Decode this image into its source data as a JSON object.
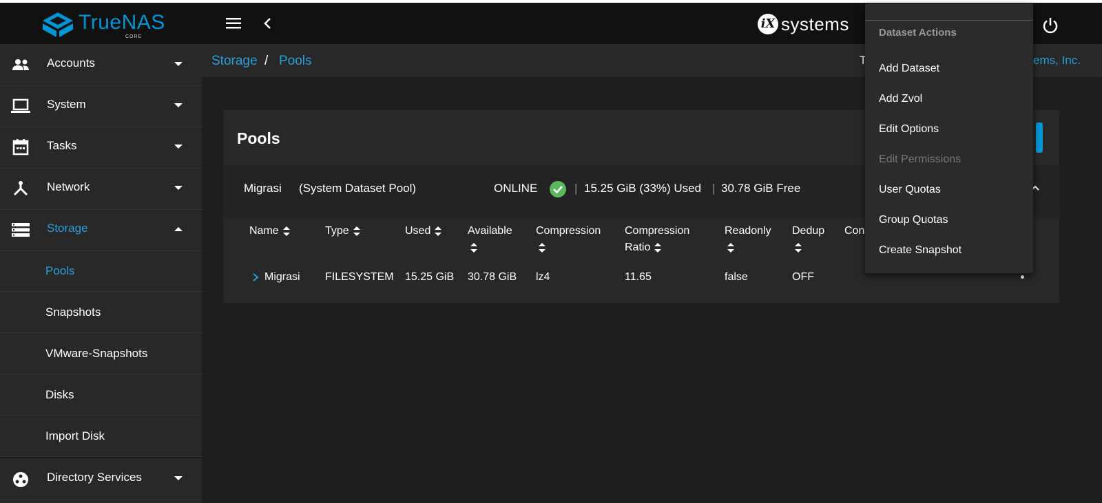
{
  "app": {
    "logo_text": "TrueNAS",
    "logo_sub": "CORE",
    "vendor_prefix": "iX",
    "vendor_text": "systems"
  },
  "icons": {
    "menu": "hamburger-icon",
    "back": "chevron-left-icon",
    "power": "power-icon"
  },
  "colors": {
    "accent": "#0095d5",
    "link": "#2a9fd8",
    "online": "#5cb85c"
  },
  "sidebar": {
    "items": [
      {
        "label": "Accounts",
        "icon": "people-icon"
      },
      {
        "label": "System",
        "icon": "laptop-icon"
      },
      {
        "label": "Tasks",
        "icon": "calendar-icon"
      },
      {
        "label": "Network",
        "icon": "network-icon"
      },
      {
        "label": "Storage",
        "icon": "storage-icon"
      },
      {
        "label": "Directory Services",
        "icon": "directory-icon"
      }
    ],
    "storage_sub": [
      "Pools",
      "Snapshots",
      "VMware-Snapshots",
      "Disks",
      "Import Disk"
    ]
  },
  "breadcrumb": {
    "parent": "Storage",
    "sep": "/",
    "current": "Pools"
  },
  "header_right": {
    "text_start": "T",
    "link_end": "ems, Inc."
  },
  "card": {
    "title": "Pools",
    "pool": {
      "name": "Migrasi",
      "label": "(System Dataset Pool)",
      "status": "ONLINE",
      "bar": "|",
      "used": "15.25 GiB (33%) Used",
      "free": "30.78 GiB Free"
    },
    "columns": {
      "name": "Name",
      "type": "Type",
      "used": "Used",
      "available": "Available",
      "compression": "Compression",
      "ratio_1": "Compression",
      "ratio_2": "Ratio",
      "readonly": "Readonly",
      "dedup": "Dedup",
      "comments": "Con"
    },
    "row": {
      "name": "Migrasi",
      "type": "FILESYSTEM",
      "used": "15.25 GiB",
      "available": "30.78 GiB",
      "compression": "lz4",
      "ratio": "11.65",
      "readonly": "false",
      "dedup": "OFF"
    }
  },
  "menu": {
    "header": "Dataset Actions",
    "items": [
      {
        "label": "Add Dataset"
      },
      {
        "label": "Add Zvol"
      },
      {
        "label": "Edit Options"
      },
      {
        "label": "Edit Permissions",
        "disabled": true
      },
      {
        "label": "User Quotas"
      },
      {
        "label": "Group Quotas"
      },
      {
        "label": "Create Snapshot"
      }
    ]
  }
}
